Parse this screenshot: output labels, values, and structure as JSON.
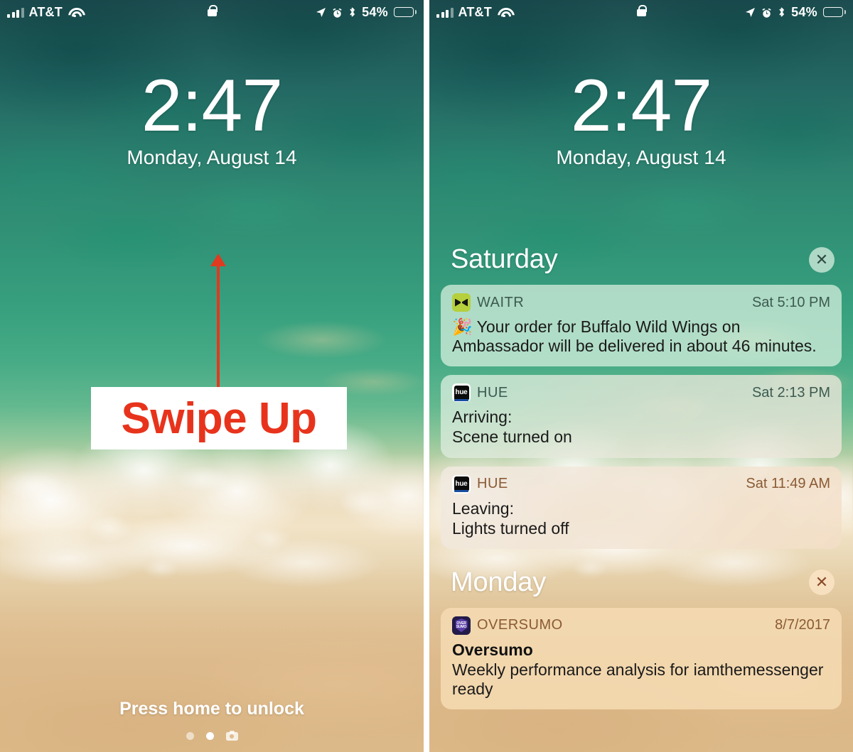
{
  "status_bar": {
    "carrier": "AT&T",
    "battery_percent": "54%",
    "icons": [
      "signal-bars-icon",
      "wifi-icon",
      "lock-icon",
      "location-arrow-icon",
      "alarm-clock-icon",
      "bluetooth-icon",
      "battery-icon"
    ]
  },
  "lock_screen": {
    "time": "2:47",
    "date": "Monday, August 14",
    "unlock_hint": "Press home to unlock",
    "annotation": {
      "label": "Swipe Up",
      "color": "#e8331c",
      "arrow_color": "#e03a20"
    },
    "page_dots": 2,
    "camera_shortcut": "camera-icon"
  },
  "notification_center": {
    "groups": [
      {
        "title": "Saturday",
        "clear_label": "✕",
        "clear_style": "teal",
        "notifications": [
          {
            "app": "WAITR",
            "icon": "waitr-bowtie-icon",
            "time": "Sat 5:10 PM",
            "emoji": "🎉",
            "body": "Your order for Buffalo Wild Wings on Ambassador will be delivered in about 46 minutes."
          },
          {
            "app": "HUE",
            "icon": "philips-hue-icon",
            "time": "Sat 2:13 PM",
            "body_line1": "Arriving:",
            "body_line2": "Scene turned on"
          },
          {
            "app": "HUE",
            "icon": "philips-hue-icon",
            "time": "Sat 11:49 AM",
            "body_line1": "Leaving:",
            "body_line2": "Lights turned off"
          }
        ]
      },
      {
        "title": "Monday",
        "clear_label": "✕",
        "clear_style": "tan",
        "notifications": [
          {
            "app": "OVERSUMO",
            "icon": "oversumo-shield-icon",
            "time": "8/7/2017",
            "title": "Oversumo",
            "body": "Weekly performance analysis for iamthemessenger ready"
          }
        ]
      }
    ]
  },
  "icon_labels": {
    "hue_text": "hue",
    "sumo_top": "OVER",
    "sumo_bottom": "SUMO"
  }
}
